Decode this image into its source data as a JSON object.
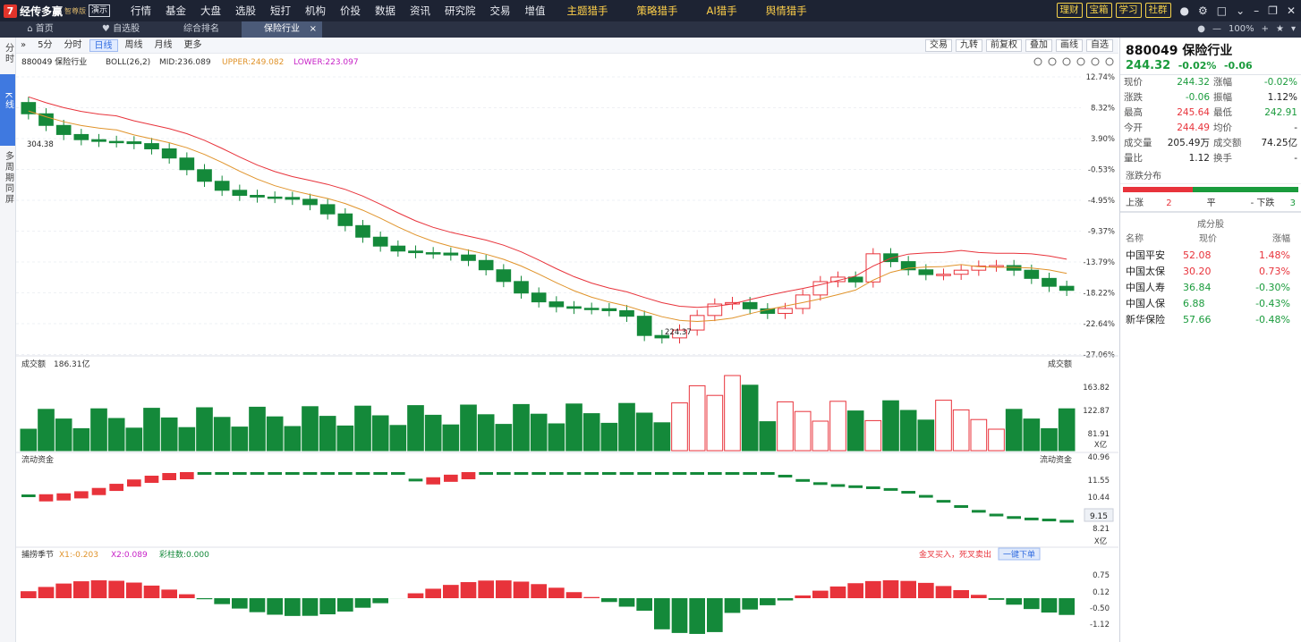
{
  "app": {
    "logo_mark": "7",
    "name": "经传多赢",
    "edition": "智尊版",
    "demo": "演示"
  },
  "menu": [
    "行情",
    "基金",
    "大盘",
    "选股",
    "短打",
    "机构",
    "价投",
    "数据",
    "资讯",
    "研究院",
    "交易",
    "增值"
  ],
  "menu_hl": [
    "主题猎手",
    "策略猎手",
    "AI猎手",
    "舆情猎手"
  ],
  "top_buttons": [
    "理财",
    "宝箱",
    "学习",
    "社群"
  ],
  "tabs": [
    {
      "label": "首页",
      "icon": "home-icon"
    },
    {
      "label": "自选股",
      "icon": "heart-icon"
    },
    {
      "label": "综合排名"
    },
    {
      "label": "保险行业",
      "active": true
    }
  ],
  "zoom": "100%",
  "side_tabs": [
    {
      "label": "分时"
    },
    {
      "label": "K线",
      "active": true
    },
    {
      "label": "多周期同屏"
    }
  ],
  "periods": [
    "5分",
    "分时",
    "日线",
    "周线",
    "月线",
    "更多"
  ],
  "period_active": "日线",
  "right_tools": [
    "交易",
    "九转",
    "前复权",
    "叠加",
    "画线",
    "自选"
  ],
  "kline": {
    "code_name": "880049 保险行业",
    "ind": "BOLL(26,2)",
    "mid": "MID:236.089",
    "upper": "UPPER:249.082",
    "lower": "LOWER:223.097",
    "ylabels": [
      "12.74%",
      "8.32%",
      "3.90%",
      "-0.53%",
      "-4.95%",
      "-9.37%",
      "-13.79%",
      "-18.22%",
      "-22.64%",
      "-27.06%"
    ],
    "high_label": "304.38",
    "low_label": "224.37"
  },
  "vol": {
    "label": "成交额",
    "value": "186.31亿",
    "right": "成交额",
    "ylabels": [
      "163.82",
      "122.87",
      "81.91",
      "40.96"
    ],
    "unit": "X亿"
  },
  "flow": {
    "label": "流动资金",
    "right": "流动资金",
    "ylabels": [
      "11.55",
      "10.44",
      "8.21"
    ],
    "current": "9.15",
    "unit": "X亿"
  },
  "osc": {
    "label": "捕捞季节",
    "x1": "X1:-0.203",
    "x2": "X2:0.089",
    "bar": "彩柱数:0.000",
    "signal": "金叉买入，死叉卖出",
    "button": "一键下单",
    "ylabels": [
      "0.75",
      "0.12",
      "-0.50",
      "-1.12"
    ]
  },
  "panel": {
    "title": "880049 保险行业",
    "price": "244.32",
    "chg_pct": "-0.02%",
    "chg": "-0.06",
    "quotes": [
      {
        "l": "现价",
        "v": "244.32",
        "vc": "green",
        "l2": "涨幅",
        "v2": "-0.02%",
        "v2c": "green"
      },
      {
        "l": "涨跌",
        "v": "-0.06",
        "vc": "green",
        "l2": "振幅",
        "v2": "1.12%",
        "v2c": "blk"
      },
      {
        "l": "最高",
        "v": "245.64",
        "vc": "red",
        "l2": "最低",
        "v2": "242.91",
        "v2c": "green"
      },
      {
        "l": "今开",
        "v": "244.49",
        "vc": "red",
        "l2": "均价",
        "v2": "-",
        "v2c": "blk"
      },
      {
        "l": "成交量",
        "v": "205.49万",
        "vc": "blk",
        "l2": "成交额",
        "v2": "74.25亿",
        "v2c": "blk"
      },
      {
        "l": "量比",
        "v": "1.12",
        "vc": "blk",
        "l2": "换手",
        "v2": "-",
        "v2c": "blk"
      }
    ],
    "dist_title": "涨跌分布",
    "up_label": "上涨",
    "up": "2",
    "flat_label": "平",
    "flat": "-",
    "down_label": "下跌",
    "down": "3",
    "comp_title": "成分股",
    "comp_head": [
      "名称",
      "现价",
      "涨幅"
    ],
    "components": [
      {
        "n": "中国平安",
        "p": "52.08",
        "c": "1.48%",
        "col": "red"
      },
      {
        "n": "中国太保",
        "p": "30.20",
        "c": "0.73%",
        "col": "red"
      },
      {
        "n": "中国人寿",
        "p": "36.84",
        "c": "-0.30%",
        "col": "green"
      },
      {
        "n": "中国人保",
        "p": "6.88",
        "c": "-0.43%",
        "col": "green"
      },
      {
        "n": "新华保险",
        "p": "57.66",
        "c": "-0.48%",
        "col": "green"
      }
    ]
  },
  "colors": {
    "up": "#e8333b",
    "down": "#14893a",
    "upper": "#e8333b",
    "mid": "#e0932a",
    "lower": "#c722c7"
  }
}
